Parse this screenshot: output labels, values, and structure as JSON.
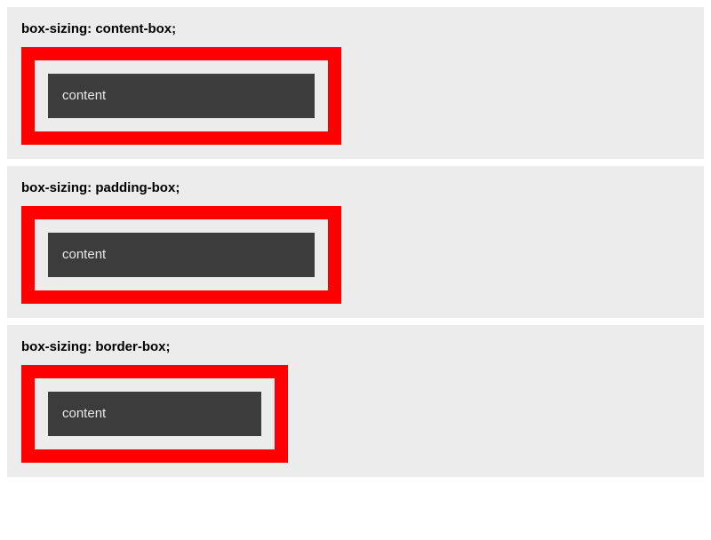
{
  "sections": [
    {
      "title": "box-sizing: content-box;",
      "content_label": "content"
    },
    {
      "title": "box-sizing: padding-box;",
      "content_label": "content"
    },
    {
      "title": "box-sizing: border-box;",
      "content_label": "content"
    }
  ]
}
